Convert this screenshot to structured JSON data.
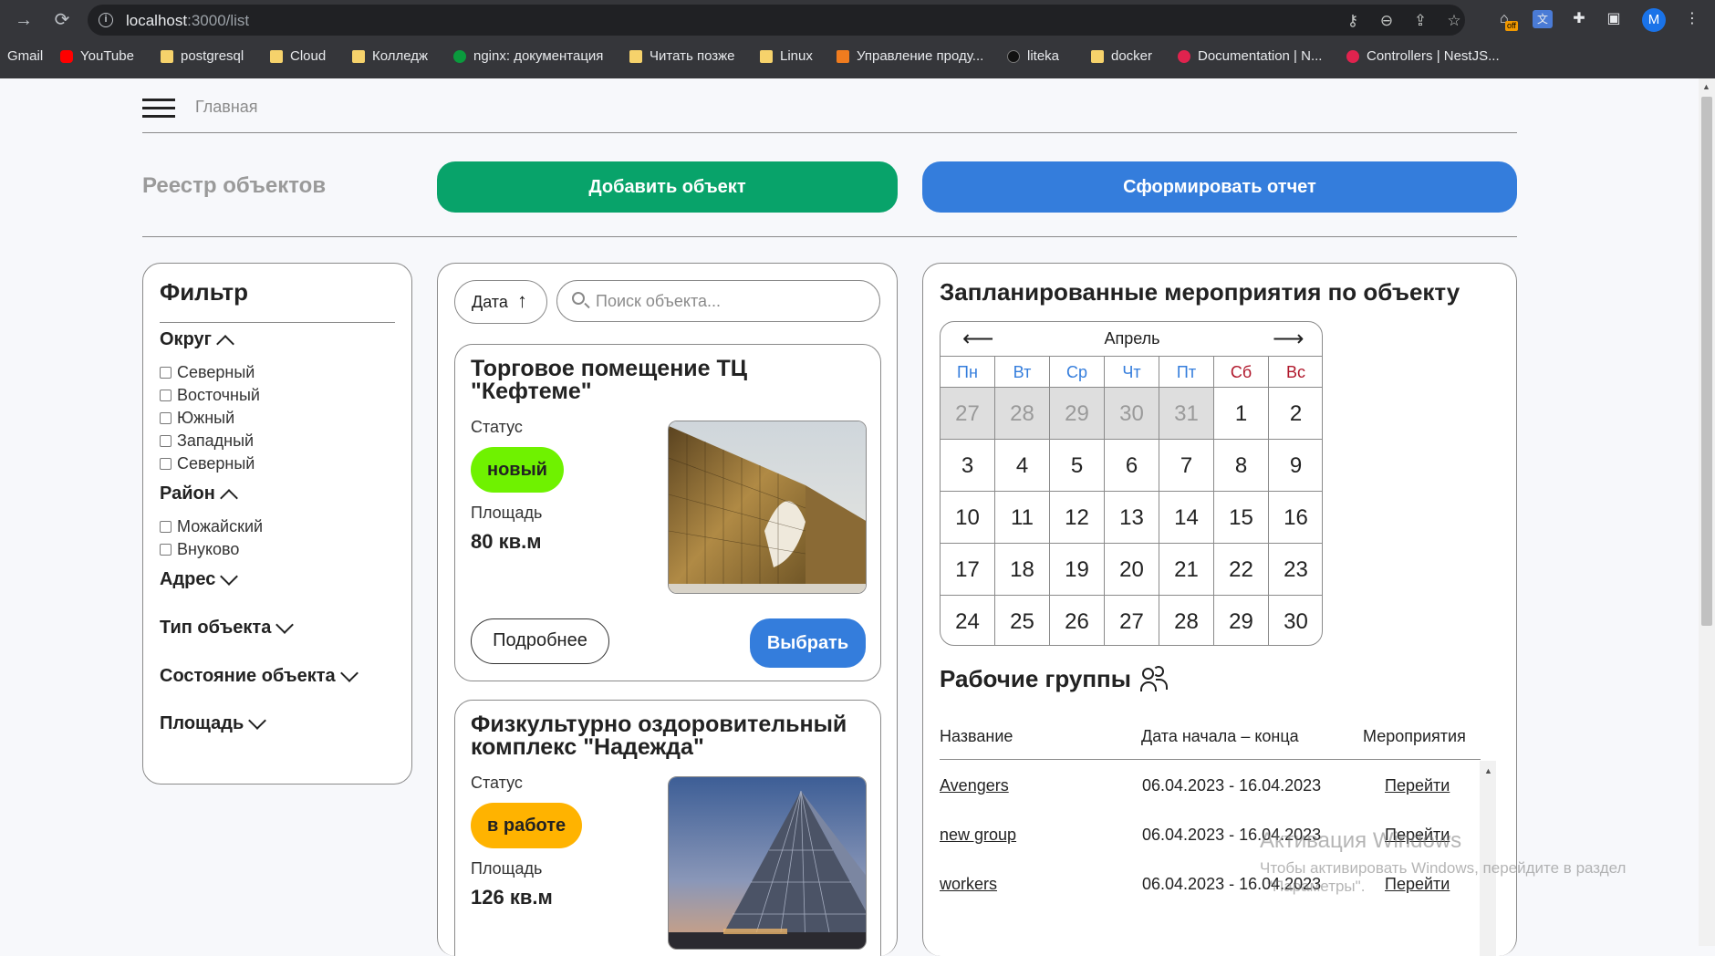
{
  "browser": {
    "url_host": "localhost",
    "url_path": ":3000/list",
    "avatar_letter": "M",
    "ext_badge": "off",
    "bookmarks": [
      {
        "label": "Gmail",
        "icon": "gmail-icon"
      },
      {
        "label": "YouTube",
        "icon": "youtube-icon"
      },
      {
        "label": "postgresql",
        "icon": "folder-icon"
      },
      {
        "label": "Cloud",
        "icon": "folder-icon"
      },
      {
        "label": "Колледж",
        "icon": "folder-icon"
      },
      {
        "label": "nginx: документация",
        "icon": "nginx-icon"
      },
      {
        "label": "Читать позже",
        "icon": "folder-icon"
      },
      {
        "label": "Linux",
        "icon": "folder-icon"
      },
      {
        "label": "Управление проду...",
        "icon": "app-icon"
      },
      {
        "label": "liteka",
        "icon": "liteka-icon"
      },
      {
        "label": "docker",
        "icon": "folder-icon"
      },
      {
        "label": "Documentation | N...",
        "icon": "nest-icon"
      },
      {
        "label": "Controllers | NestJS...",
        "icon": "nest-icon"
      }
    ]
  },
  "header": {
    "home_label": "Главная"
  },
  "toolbar": {
    "title": "Реестр объектов",
    "add_label": "Добавить объект",
    "report_label": "Сформировать отчет"
  },
  "filter": {
    "title": "Фильтр",
    "okrug_label": "Округ",
    "okrug_options": [
      "Северный",
      "Восточный",
      "Южный",
      "Западный",
      "Северный"
    ],
    "rayon_label": "Район",
    "rayon_options": [
      "Можайский",
      "Внуково"
    ],
    "address_label": "Адрес",
    "type_label": "Тип объекта",
    "state_label": "Состояние объекта",
    "area_label": "Площадь"
  },
  "list": {
    "sort_label": "Дата",
    "search_placeholder": "Поиск объекта...",
    "status_label": "Статус",
    "area_label": "Площадь",
    "details_label": "Подробнее",
    "choose_label": "Выбрать",
    "cards": [
      {
        "title": "Торговое помещение ТЦ \"Кефтеме\"",
        "status": "новый",
        "status_color": "#6ff200",
        "area": "80 кв.м"
      },
      {
        "title": "Физкультурно оздоровительный комплекс \"Надежда\"",
        "status": "в работе",
        "status_color": "#ffb300",
        "area": "126 кв.м"
      }
    ]
  },
  "events": {
    "title": "Запланированные мероприятия по объекту",
    "calendar": {
      "month": "Апрель",
      "weekdays": [
        "Пн",
        "Вт",
        "Ср",
        "Чт",
        "Пт",
        "Сб",
        "Вс"
      ],
      "prev_days": [
        "27",
        "28",
        "29",
        "30",
        "31"
      ],
      "days": [
        "1",
        "2",
        "3",
        "4",
        "5",
        "6",
        "7",
        "8",
        "9",
        "10",
        "11",
        "12",
        "13",
        "14",
        "15",
        "16",
        "17",
        "18",
        "19",
        "20",
        "21",
        "22",
        "23",
        "24",
        "25",
        "26",
        "27",
        "28",
        "29",
        "30"
      ]
    }
  },
  "groups": {
    "title": "Рабочие группы",
    "col_name": "Название",
    "col_dates": "Дата начала – конца",
    "col_events": "Мероприятия",
    "rows": [
      {
        "name": "Avengers",
        "dates": "06.04.2023 - 16.04.2023",
        "action": "Перейти"
      },
      {
        "name": "new group",
        "dates": "06.04.2023 - 16.04.2023",
        "action": "Перейти"
      },
      {
        "name": "workers",
        "dates": "06.04.2023 - 16.04.2023",
        "action": "Перейти"
      }
    ]
  },
  "watermark": {
    "line1": "Активация Windows",
    "line2": "Чтобы активировать Windows, перейдите в раздел",
    "line3": "\"Параметры\"."
  }
}
